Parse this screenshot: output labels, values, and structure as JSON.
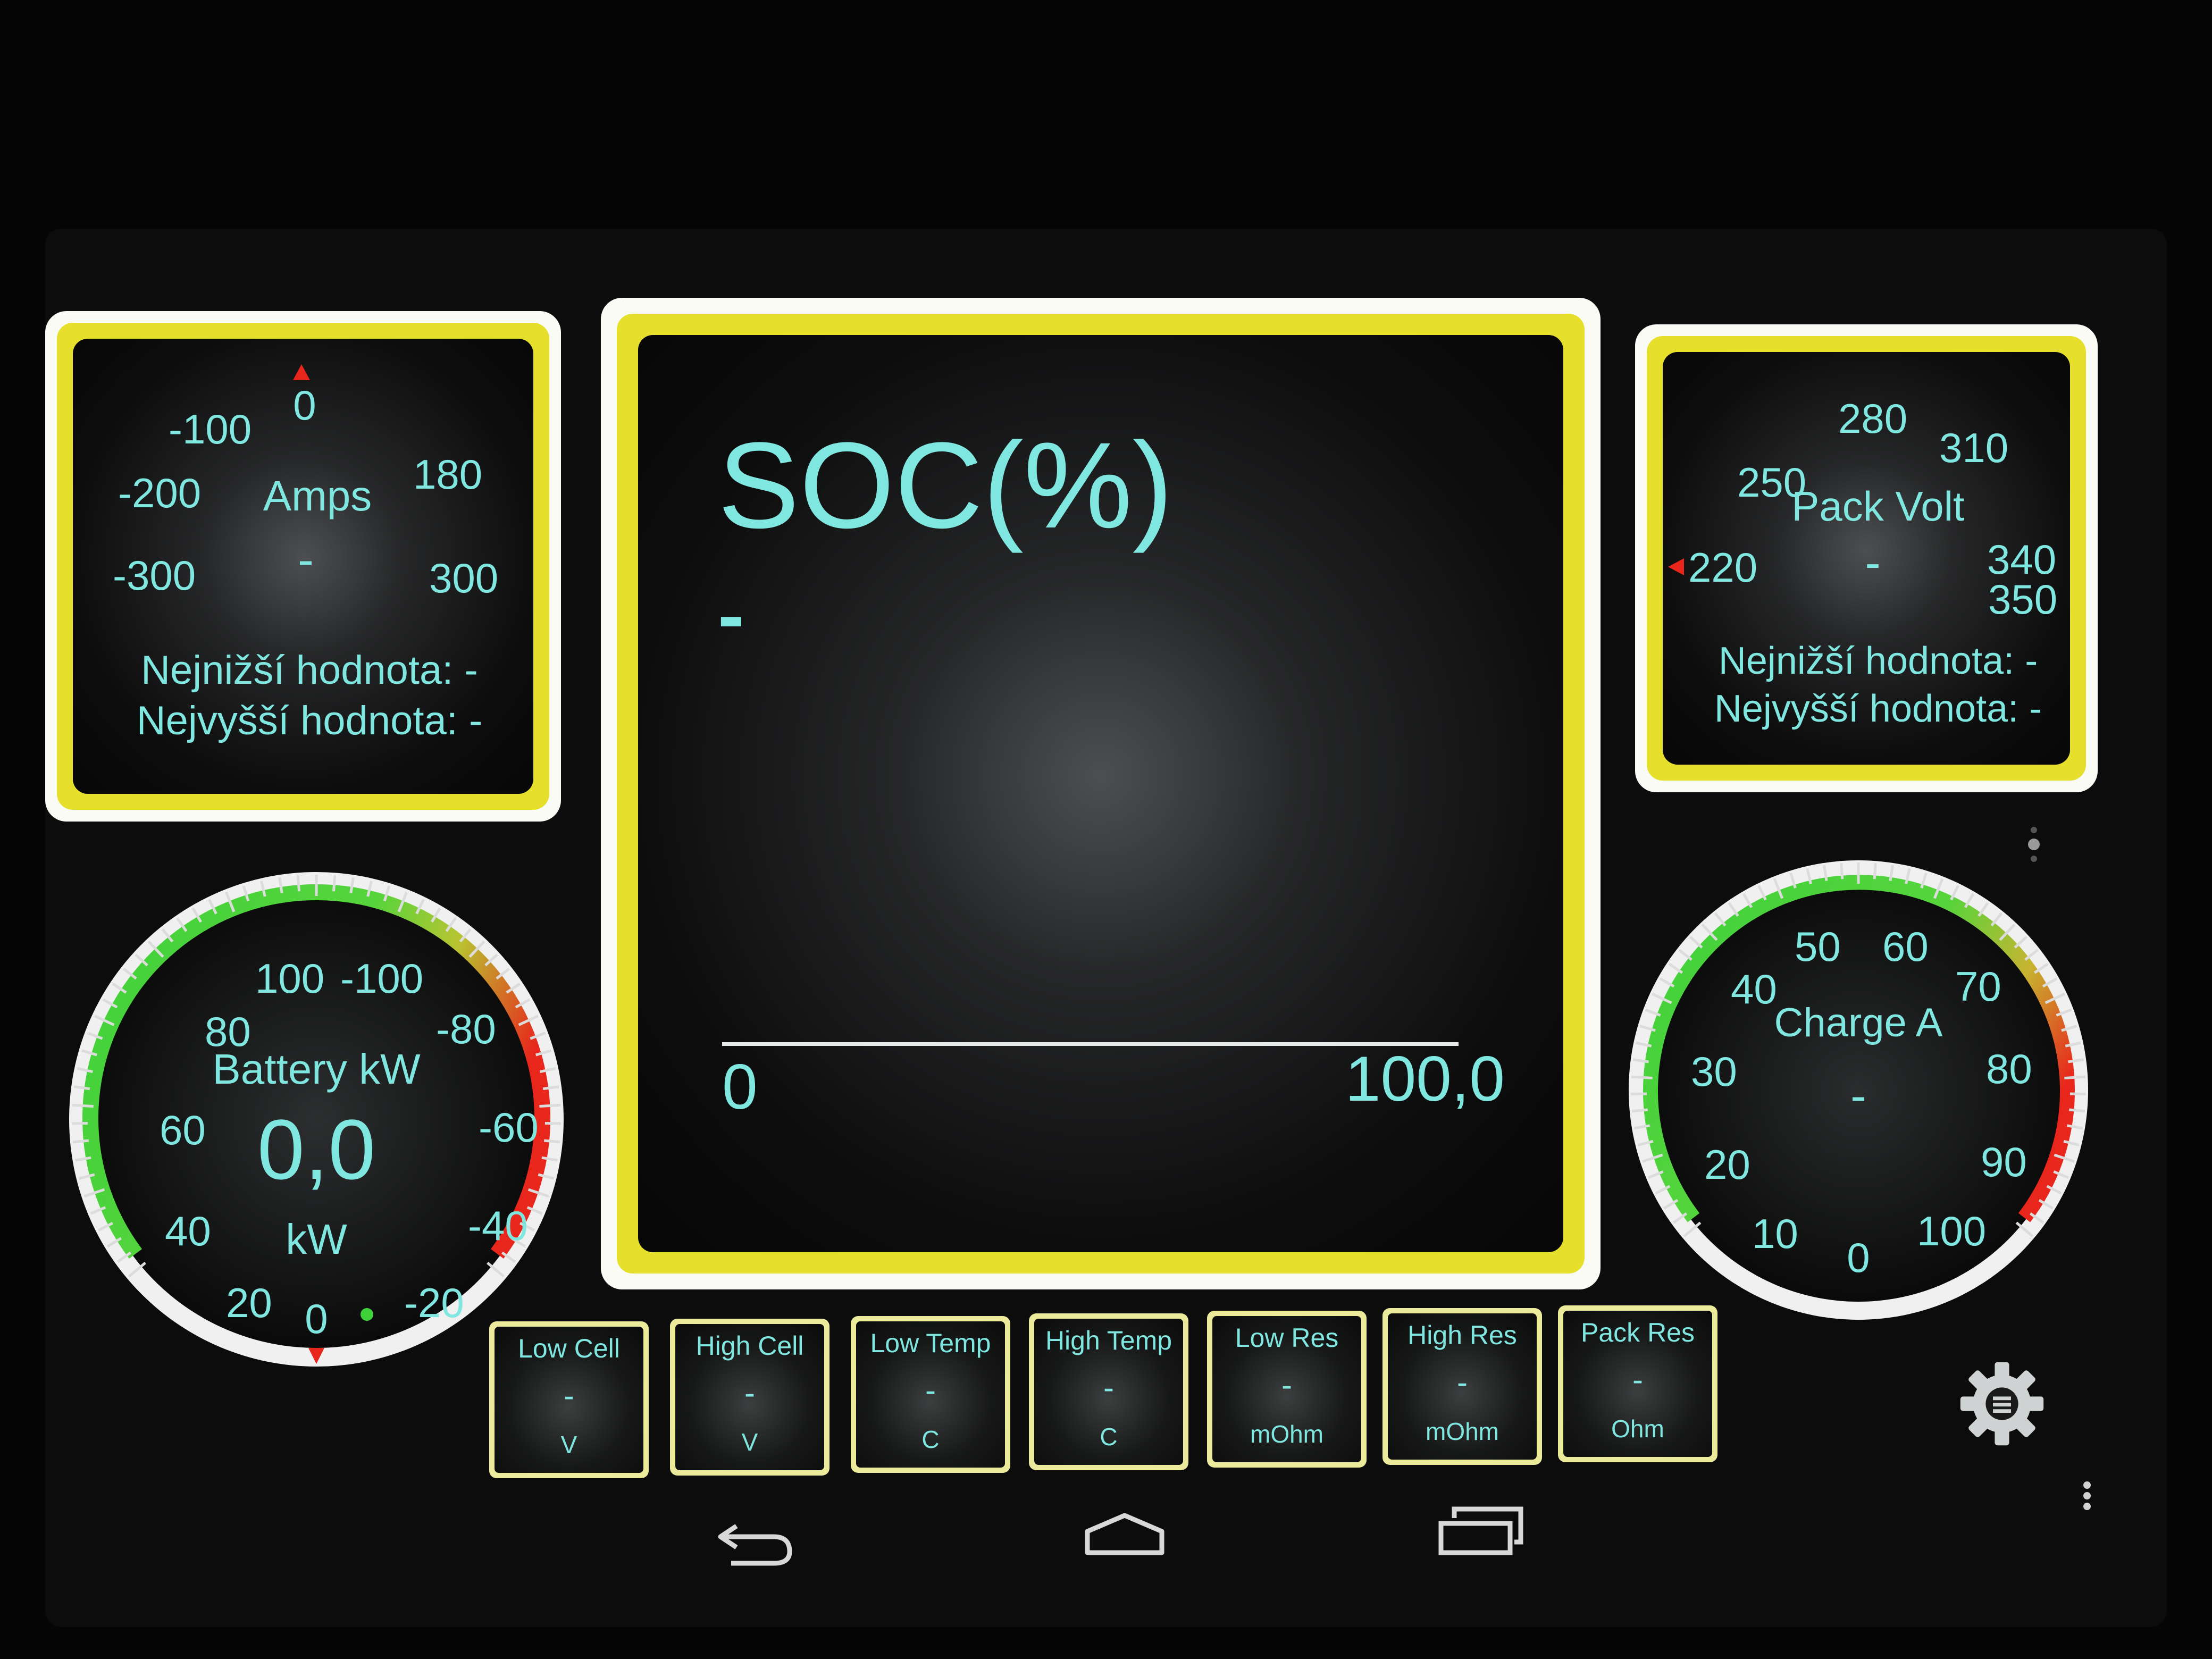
{
  "amps_gauge": {
    "title": "Amps",
    "value": "-",
    "ticks": [
      "0",
      "-100",
      "-200",
      "-300",
      "180",
      "300"
    ],
    "min_label": "Nejnižší hodnota: -",
    "max_label": "Nejvyšší hodnota: -"
  },
  "soc_panel": {
    "title": "SOC(%)",
    "value": "-",
    "min": "0",
    "max": "100,0"
  },
  "pack_volt_gauge": {
    "title": "Pack Volt",
    "value": "-",
    "ticks": [
      "280",
      "310",
      "250",
      "340",
      "350",
      "220"
    ],
    "min_label": "Nejnižší hodnota: -",
    "max_label": "Nejvyšší hodnota: -"
  },
  "battery_gauge": {
    "title": "Battery kW",
    "value": "0,0",
    "unit": "kW",
    "ticks": [
      "100",
      "-100",
      "80",
      "-80",
      "60",
      "-60",
      "40",
      "-40",
      "20",
      "-20",
      "0"
    ]
  },
  "charge_gauge": {
    "title": "Charge  A",
    "value": "-",
    "ticks": [
      "50",
      "60",
      "40",
      "70",
      "30",
      "80",
      "20",
      "90",
      "10",
      "100",
      "0"
    ]
  },
  "tiles": [
    {
      "label": "Low Cell",
      "value": "-",
      "unit": "V"
    },
    {
      "label": "High Cell",
      "value": "-",
      "unit": "V"
    },
    {
      "label": "Low Temp",
      "value": "-",
      "unit": "C"
    },
    {
      "label": "High Temp",
      "value": "-",
      "unit": "C"
    },
    {
      "label": "Low Res",
      "value": "-",
      "unit": "mOhm"
    },
    {
      "label": "High Res",
      "value": "-",
      "unit": "mOhm"
    },
    {
      "label": "Pack Res",
      "value": "-",
      "unit": "Ohm"
    }
  ],
  "icons": {
    "settings": "gear-icon",
    "overflow": "overflow-menu-icon",
    "back": "back-icon",
    "home": "home-icon",
    "recents": "recents-icon"
  },
  "colors": {
    "accent_text": "#7fe6e0",
    "panel_border": "#e6e02c",
    "gauge_green": "#3fd13a",
    "gauge_red": "#e8261c",
    "needle_red": "#e8261c"
  }
}
